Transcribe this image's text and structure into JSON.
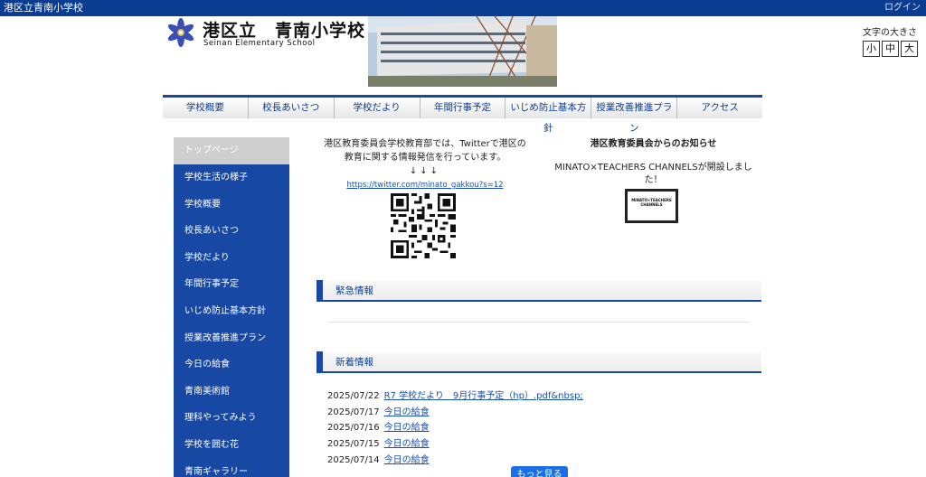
{
  "topbar": {
    "site_name": "港区立青南小学校",
    "login": "ログイン"
  },
  "header": {
    "title": "港区立　青南小学校",
    "subtitle": "Seinan Elementary School",
    "logo_icon": "flower-emblem-icon",
    "photo": "school-building-photo"
  },
  "font_size": {
    "label": "文字の大きさ",
    "small": "小",
    "medium": "中",
    "large": "大"
  },
  "global_nav": {
    "items": [
      {
        "label": "学校概要"
      },
      {
        "label": "校長あいさつ"
      },
      {
        "label": "学校だより"
      },
      {
        "label": "年間行事予定"
      },
      {
        "label": "いじめ防止基本方針"
      },
      {
        "label": "授業改善推進プラン"
      },
      {
        "label": "アクセス"
      }
    ]
  },
  "sidebar": {
    "items": [
      {
        "label": "トップページ"
      },
      {
        "label": "学校生活の様子"
      },
      {
        "label": "学校概要"
      },
      {
        "label": "校長あいさつ"
      },
      {
        "label": "学校だより"
      },
      {
        "label": "年間行事予定"
      },
      {
        "label": "いじめ防止基本方針"
      },
      {
        "label": "授業改善推進プラン"
      },
      {
        "label": "今日の給食"
      },
      {
        "label": "青南美術館"
      },
      {
        "label": "理科やってみよう"
      },
      {
        "label": "学校を囲む花"
      },
      {
        "label": "青南ギャラリー"
      }
    ]
  },
  "notice_left": {
    "line1": "港区教育委員会学校教育部では、Twitterで港区の",
    "line2": "教育に関する情報発信を行っています。",
    "arrows": "↓↓↓",
    "link": "https://twitter.com/minato_gakkou?s=12"
  },
  "notice_right": {
    "heading": "港区教育委員会からのお知らせ",
    "text": "MINATO×TEACHERS CHANNELSが開設しました！",
    "banner_line1": "MINATO×TEACHERS",
    "banner_line2": "CHANNELS"
  },
  "sections": {
    "urgent": "緊急情報",
    "news": "新着情報"
  },
  "news": {
    "items": [
      {
        "date": "2025/07/22",
        "title": "R7 学校だより　9月行事予定（hp）.pdf&nbsp;"
      },
      {
        "date": "2025/07/17",
        "title": "今日の給食"
      },
      {
        "date": "2025/07/16",
        "title": "今日の給食"
      },
      {
        "date": "2025/07/15",
        "title": "今日の給食"
      },
      {
        "date": "2025/07/14",
        "title": "今日の給食"
      }
    ],
    "more": "もっと見る"
  },
  "colors": {
    "brand_blue": "#1748a3",
    "topbar_blue": "#0a3d91",
    "link_blue": "#1a4fb3",
    "button_blue": "#1a6fe8"
  }
}
